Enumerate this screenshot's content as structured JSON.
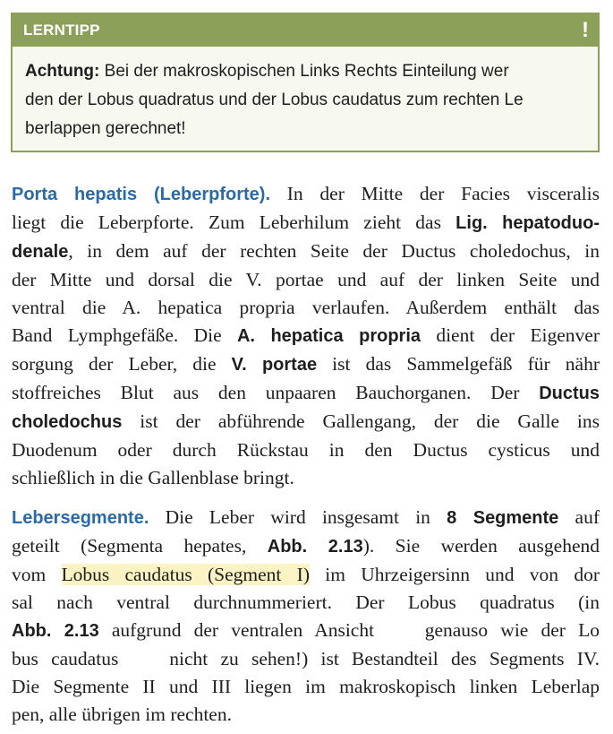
{
  "tip": {
    "title": "LERNTIPP",
    "icon": "exclamation-icon",
    "icon_glyph": "!",
    "lines": [
      {
        "bold": "Achtung:",
        "text": " Bei der makroskopischen Links Rechts Einteilung wer"
      },
      {
        "bold": "",
        "text": "den der Lobus quadratus und der Lobus caudatus zum rechten Le"
      },
      {
        "bold": "",
        "text": "berlappen gerechnet!"
      }
    ]
  },
  "para1": {
    "heading": "Porta hepatis (Leberpforte).",
    "l1_rest": " In der Mitte der Facies visceralis",
    "l2_text": "liegt die Leberpforte. Zum Leberhilum zieht das ",
    "l2_bold": "Lig. hepatoduo-",
    "l3_bold": "denale",
    "l3_text": ", in dem auf der rechten Seite der Ductus choledochus, in",
    "l4": "der Mitte und dorsal die V. portae und auf der linken Seite und",
    "l5": "ventral die A. hepatica propria verlaufen. Außerdem enthält das",
    "l6_text": "Band Lymphgefäße. Die ",
    "l6_bold": "A. hepatica propria",
    "l6_rest": " dient der Eigenver",
    "l7_text": "sorgung der Leber, die ",
    "l7_bold": "V. portae",
    "l7_rest": " ist das Sammelgefäß für nähr",
    "l8_text": "stoffreiches Blut aus den unpaaren Bauchorganen. Der ",
    "l8_bold": "Ductus",
    "l9_bold": "choledochus",
    "l9_rest": " ist der abführende Gallengang, der die Galle ins",
    "l10": "Duodenum oder durch Rückstau in den Ductus cysticus und",
    "l11": "schließlich in die Gallenblase bringt."
  },
  "para2": {
    "heading": "Lebersegmente.",
    "l1_text": " Die Leber wird insgesamt in ",
    "l1_bold": "8 Segmente",
    "l1_rest": " auf",
    "l2_text": "geteilt (Segmenta hepates, ",
    "l2_bold": "Abb. 2.13",
    "l2_rest": "). Sie werden ausgehend",
    "l3_text": "vom ",
    "l3_highlight": "Lobus caudatus (Segment I)",
    "l3_rest": " im Uhrzeigersinn und von dor",
    "l4": "sal nach ventral durchnummeriert. Der Lobus quadratus (in",
    "l5_bold": "Abb. 2.13",
    "l5_rest": " aufgrund der ventralen Ansicht    genauso wie der Lo",
    "l6": "bus caudatus    nicht zu sehen!) ist Bestandteil des Segments IV.",
    "l7": "Die Segmente II und III liegen im makroskopisch linken Leberlap",
    "l8": "pen, alle übrigen im rechten."
  }
}
